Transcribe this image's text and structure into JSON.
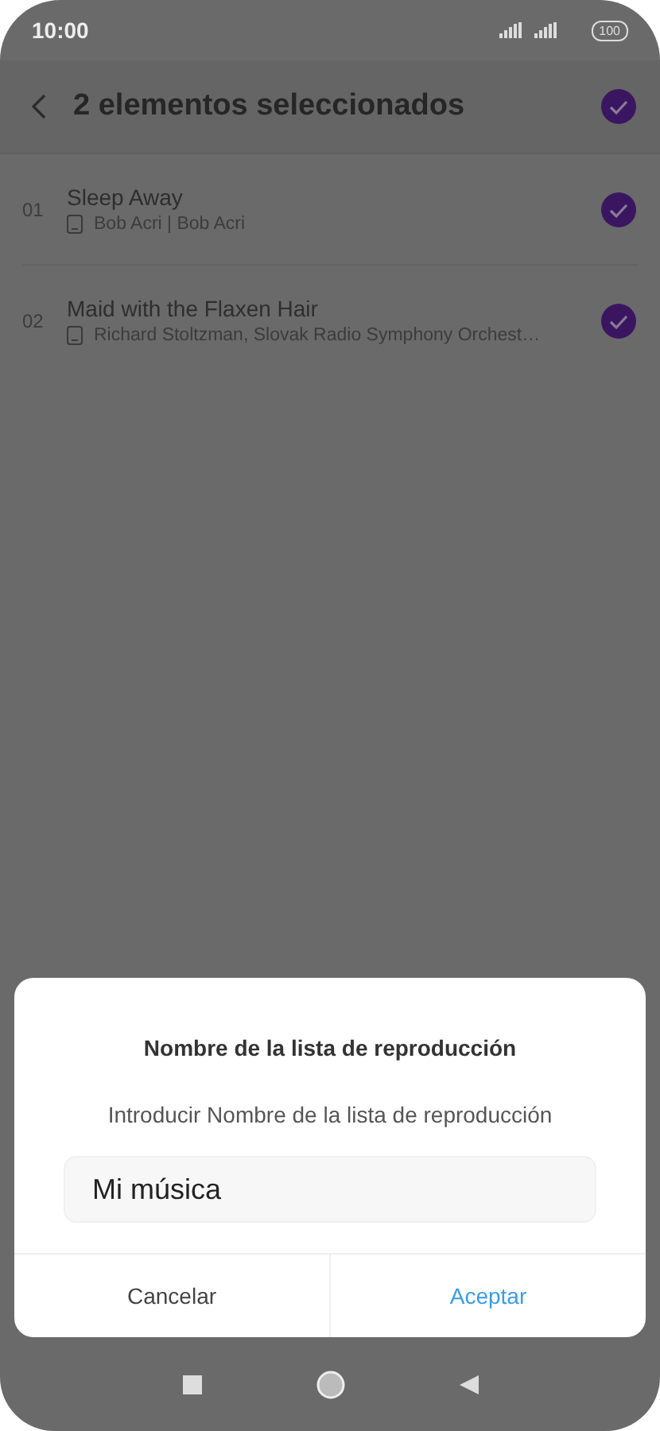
{
  "status_bar": {
    "time": "10:00",
    "battery": "100"
  },
  "header": {
    "title": "2 elementos seleccionados",
    "select_all": {
      "selected": true
    }
  },
  "songs": [
    {
      "number": "01",
      "title": "Sleep Away",
      "subtitle": "Bob Acri | Bob Acri",
      "selected": true
    },
    {
      "number": "02",
      "title": "Maid with the Flaxen Hair",
      "subtitle": "Richard Stoltzman, Slovak Radio Symphony Orchest…",
      "selected": true
    }
  ],
  "dialog": {
    "title": "Nombre de la lista de reproducción",
    "message": "Introducir Nombre de la lista de reproducción",
    "field": {
      "value": "Mi música"
    },
    "buttons": [
      {
        "label": "Cancelar",
        "kind": "cancel"
      },
      {
        "label": "Aceptar",
        "kind": "confirm"
      }
    ]
  }
}
